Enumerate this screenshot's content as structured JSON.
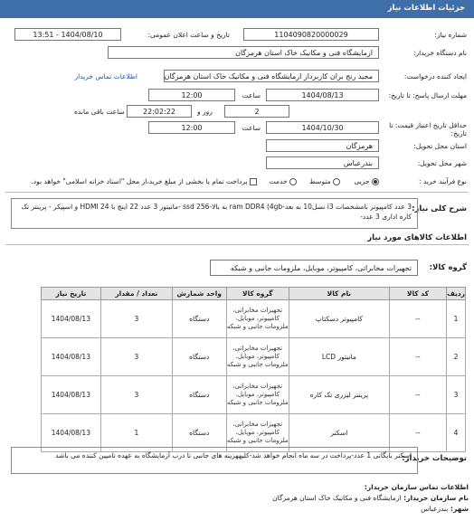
{
  "header": {
    "title": "جزئیات اطلاعات نیاز"
  },
  "form": {
    "need_number_label": "شماره نیاز:",
    "need_number": "1104090820000029",
    "announce_label": "تاریخ و ساعت اعلان عمومی:",
    "announce_value": "1404/08/10 - 13:51",
    "buyer_label": "نام دستگاه خریدار:",
    "buyer_value": "ازمایشگاه فنی و مکانیک خاک استان هرمزگان",
    "creator_label": "ایجاد کننده درخواست:",
    "creator_value": "مجید رنج بران کاربرداز ازمایشگاه فنی و مکانیک خاک استان هرمزگان",
    "buyer_contact_link": "اطلاعات تماس خریدار",
    "reply_deadline_label": "مهلت ارسال پاسخ: تا تاریخ:",
    "reply_date": "1404/08/13",
    "time_label": "ساعت",
    "reply_time": "12:00",
    "days_value": "2",
    "days_label": "روز و",
    "remaining_time": "22:02:22",
    "remaining_label": "ساعت باقی مانده",
    "validity_label": "حداقل تاریخ اعتبار قیمت: تا تاریخ:",
    "validity_date": "1404/10/30",
    "validity_time": "12:00",
    "province_label": "استان محل تحویل:",
    "province_value": "هرمزگان",
    "city_label": "شهر محل تحویل:",
    "city_value": "بندرعباس",
    "process_label": "نوع فرآیند خرید :",
    "process_options": [
      "جزیی",
      "متوسط",
      "خدمت"
    ],
    "payment_note": "پرداخت تمام یا بخشی از مبلغ خرید،از محل \"اسناد خزانه اسلامی\" خواهد بود."
  },
  "summary": {
    "label": "شرح کلی نیاز:",
    "text": "3 عدد کامپیوتر بامشخصات i3 نسل10 به بعد-ram DDR4 (4gb به بالا-ssd 256 -مانیتور 3 عدد 22 اینچ با HDMI 24 و اسپیکر - پرینتر تک کاره اداری 3 عدد-"
  },
  "goods": {
    "title": "اطلاعات کالاهای مورد نیاز",
    "group_label": "گروه کالا:",
    "group_value": "تجهیزات مخابراتی، کامپیوتر، موبایل، ملزومات جانبی و شبکه",
    "columns": [
      "ردیف",
      "کد کالا",
      "نام کالا",
      "واحد شمارش",
      "تعداد / مقدار",
      "تاریخ نیاز"
    ],
    "group_col": "گروه کالا",
    "rows": [
      {
        "idx": "1",
        "code": "--",
        "name": "کامپیوتر دسکتاپ",
        "group": "تجهیزات مخابراتی، کامپیوتر، موبایل، ملزومات جانبی و شبکه",
        "unit": "دستگاه",
        "qty": "3",
        "date": "1404/08/13"
      },
      {
        "idx": "2",
        "code": "--",
        "name": "مانیتور LCD",
        "group": "تجهیزات مخابراتی، کامپیوتر، موبایل، ملزومات جانبی و شبکه",
        "unit": "دستگاه",
        "qty": "3",
        "date": "1404/08/13"
      },
      {
        "idx": "3",
        "code": "--",
        "name": "پرینتر لیزری تک کاره",
        "group": "تجهیزات مخابراتی، کامپیوتر، موبایل، ملزومات جانبی و شبکه",
        "unit": "دستگاه",
        "qty": "3",
        "date": "1404/08/13"
      },
      {
        "idx": "4",
        "code": "--",
        "name": "اسکنر",
        "group": "تجهیزات مخابراتی، کامپیوتر، موبایل، ملزومات جانبی و شبکه",
        "unit": "دستگاه",
        "qty": "1",
        "date": "1404/08/13"
      }
    ]
  },
  "buyer_notes": {
    "label": "توضیحات خریدار:",
    "text": "اسکنر بایگانی 1 عدد-پرداخت در سه ماه انجام خواهد شد-کلیههزینه های جانبی تا درب آزمایشگاه به عهده تامیین کننده می باشد"
  },
  "contact": {
    "title": "اطلاعات تماس سازمان خریدار:",
    "org_label": "نام سازمان خریدار:",
    "org_value": "ازمایشگاه فنی و مکانیک خاک استان هرمزگان",
    "city_label": "شهر:",
    "city_value": "بندرعباس"
  }
}
